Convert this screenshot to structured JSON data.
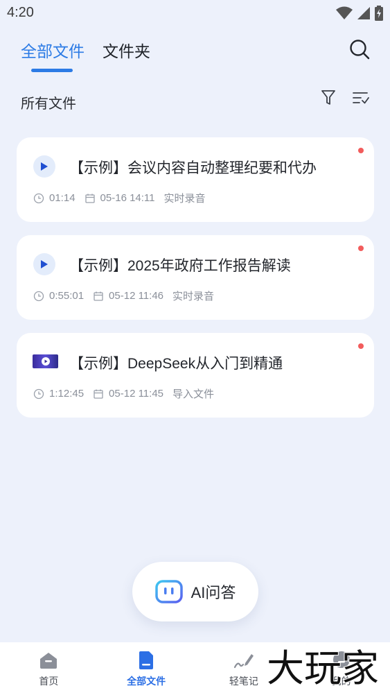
{
  "status_bar": {
    "time": "4:20"
  },
  "header": {
    "tabs": [
      {
        "label": "全部文件",
        "active": true
      },
      {
        "label": "文件夹",
        "active": false
      }
    ],
    "accent_color": "#2c7be5"
  },
  "toolbar": {
    "title": "所有文件"
  },
  "files": [
    {
      "title": "【示例】会议内容自动整理纪要和代办",
      "duration": "01:14",
      "date": "05-16 14:11",
      "source": "实时录音",
      "thumb": "play-icon"
    },
    {
      "title": "【示例】2025年政府工作报告解读",
      "duration": "0:55:01",
      "date": "05-12 11:46",
      "source": "实时录音",
      "thumb": "play-icon"
    },
    {
      "title": "【示例】DeepSeek从入门到精通",
      "duration": "1:12:45",
      "date": "05-12 11:45",
      "source": "导入文件",
      "thumb": "video-thumbnail"
    }
  ],
  "ai_button": {
    "label": "AI问答"
  },
  "bottom_nav": [
    {
      "label": "首页",
      "icon": "home-icon",
      "active": false
    },
    {
      "label": "全部文件",
      "icon": "document-icon",
      "active": true
    },
    {
      "label": "轻笔记",
      "icon": "pen-icon",
      "active": false
    },
    {
      "label": "我的",
      "icon": "user-icon",
      "active": false
    }
  ],
  "watermark": {
    "text": "大玩家"
  }
}
